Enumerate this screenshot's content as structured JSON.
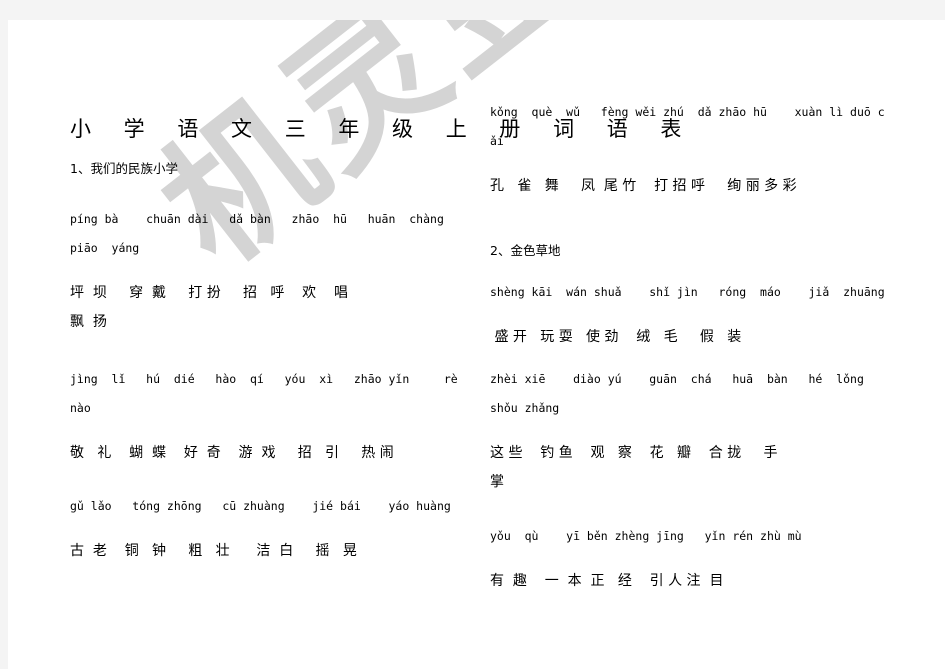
{
  "document": {
    "title": "小 学 语 文 三 年 级 上 册 词 语 表",
    "watermark_text": "机灵豆",
    "watermark_color": "#d4d4d4",
    "page_background": "#ffffff",
    "canvas_background": "#f4f4f4",
    "text_color": "#000000"
  },
  "left_column": {
    "lesson_heading": "1、我们的民族小学",
    "entries": [
      {
        "pinyin_line_1": "píng bà    chuān dài   dǎ bàn   zhāo  hū   huān  chàng",
        "pinyin_line_2": "piāo  yáng",
        "hanzi_line_1": "坪  坝     穿  戴     打 扮     招   呼    欢    唱",
        "hanzi_line_2": "飘  扬"
      },
      {
        "pinyin_line_1": "jìng  lǐ   hú  dié   hào  qí   yóu  xì   zhāo yǐn     rè",
        "pinyin_line_2": "nào",
        "hanzi_line_1": "敬   礼    蝴  蝶    好  奇    游  戏     招   引     热 闹",
        "hanzi_line_2": ""
      },
      {
        "pinyin_line_1": "gǔ lǎo   tóng zhōng   cū zhuàng    jié bái    yáo huàng",
        "pinyin_line_2": "",
        "hanzi_line_1": "古  老    铜   钟     粗   壮      洁  白     摇   晃",
        "hanzi_line_2": ""
      }
    ]
  },
  "right_column": {
    "entries_before_heading": [
      {
        "pinyin_line_1": "kǒng  què  wǔ   fèng wěi zhú  dǎ zhāo hū    xuàn lì duō c",
        "pinyin_line_2": "ǎi",
        "hanzi_line_1": "孔   雀   舞     凤  尾 竹    打 招 呼     绚 丽 多 彩",
        "hanzi_line_2": ""
      }
    ],
    "lesson_heading": "2、金色草地",
    "entries": [
      {
        "pinyin_line_1": "shèng kāi  wán shuǎ    shǐ jìn   róng  máo    jiǎ  zhuāng",
        "pinyin_line_2": "",
        "hanzi_line_1": " 盛 开   玩 耍   使 劲    绒   毛     假   装",
        "hanzi_line_2": ""
      },
      {
        "pinyin_line_1": "zhèi xiē    diào yú    guān  chá   huā  bàn   hé  lǒng",
        "pinyin_line_2": "shǒu zhǎng",
        "hanzi_line_1": "这 些    钓 鱼    观   察    花   瓣    合 拢     手",
        "hanzi_line_2": "掌"
      },
      {
        "pinyin_line_1": "yǒu  qù    yī běn zhèng jīng   yǐn rén zhù mù",
        "pinyin_line_2": "",
        "hanzi_line_1": "有  趣    一  本  正   经    引 人 注  目",
        "hanzi_line_2": ""
      }
    ]
  }
}
